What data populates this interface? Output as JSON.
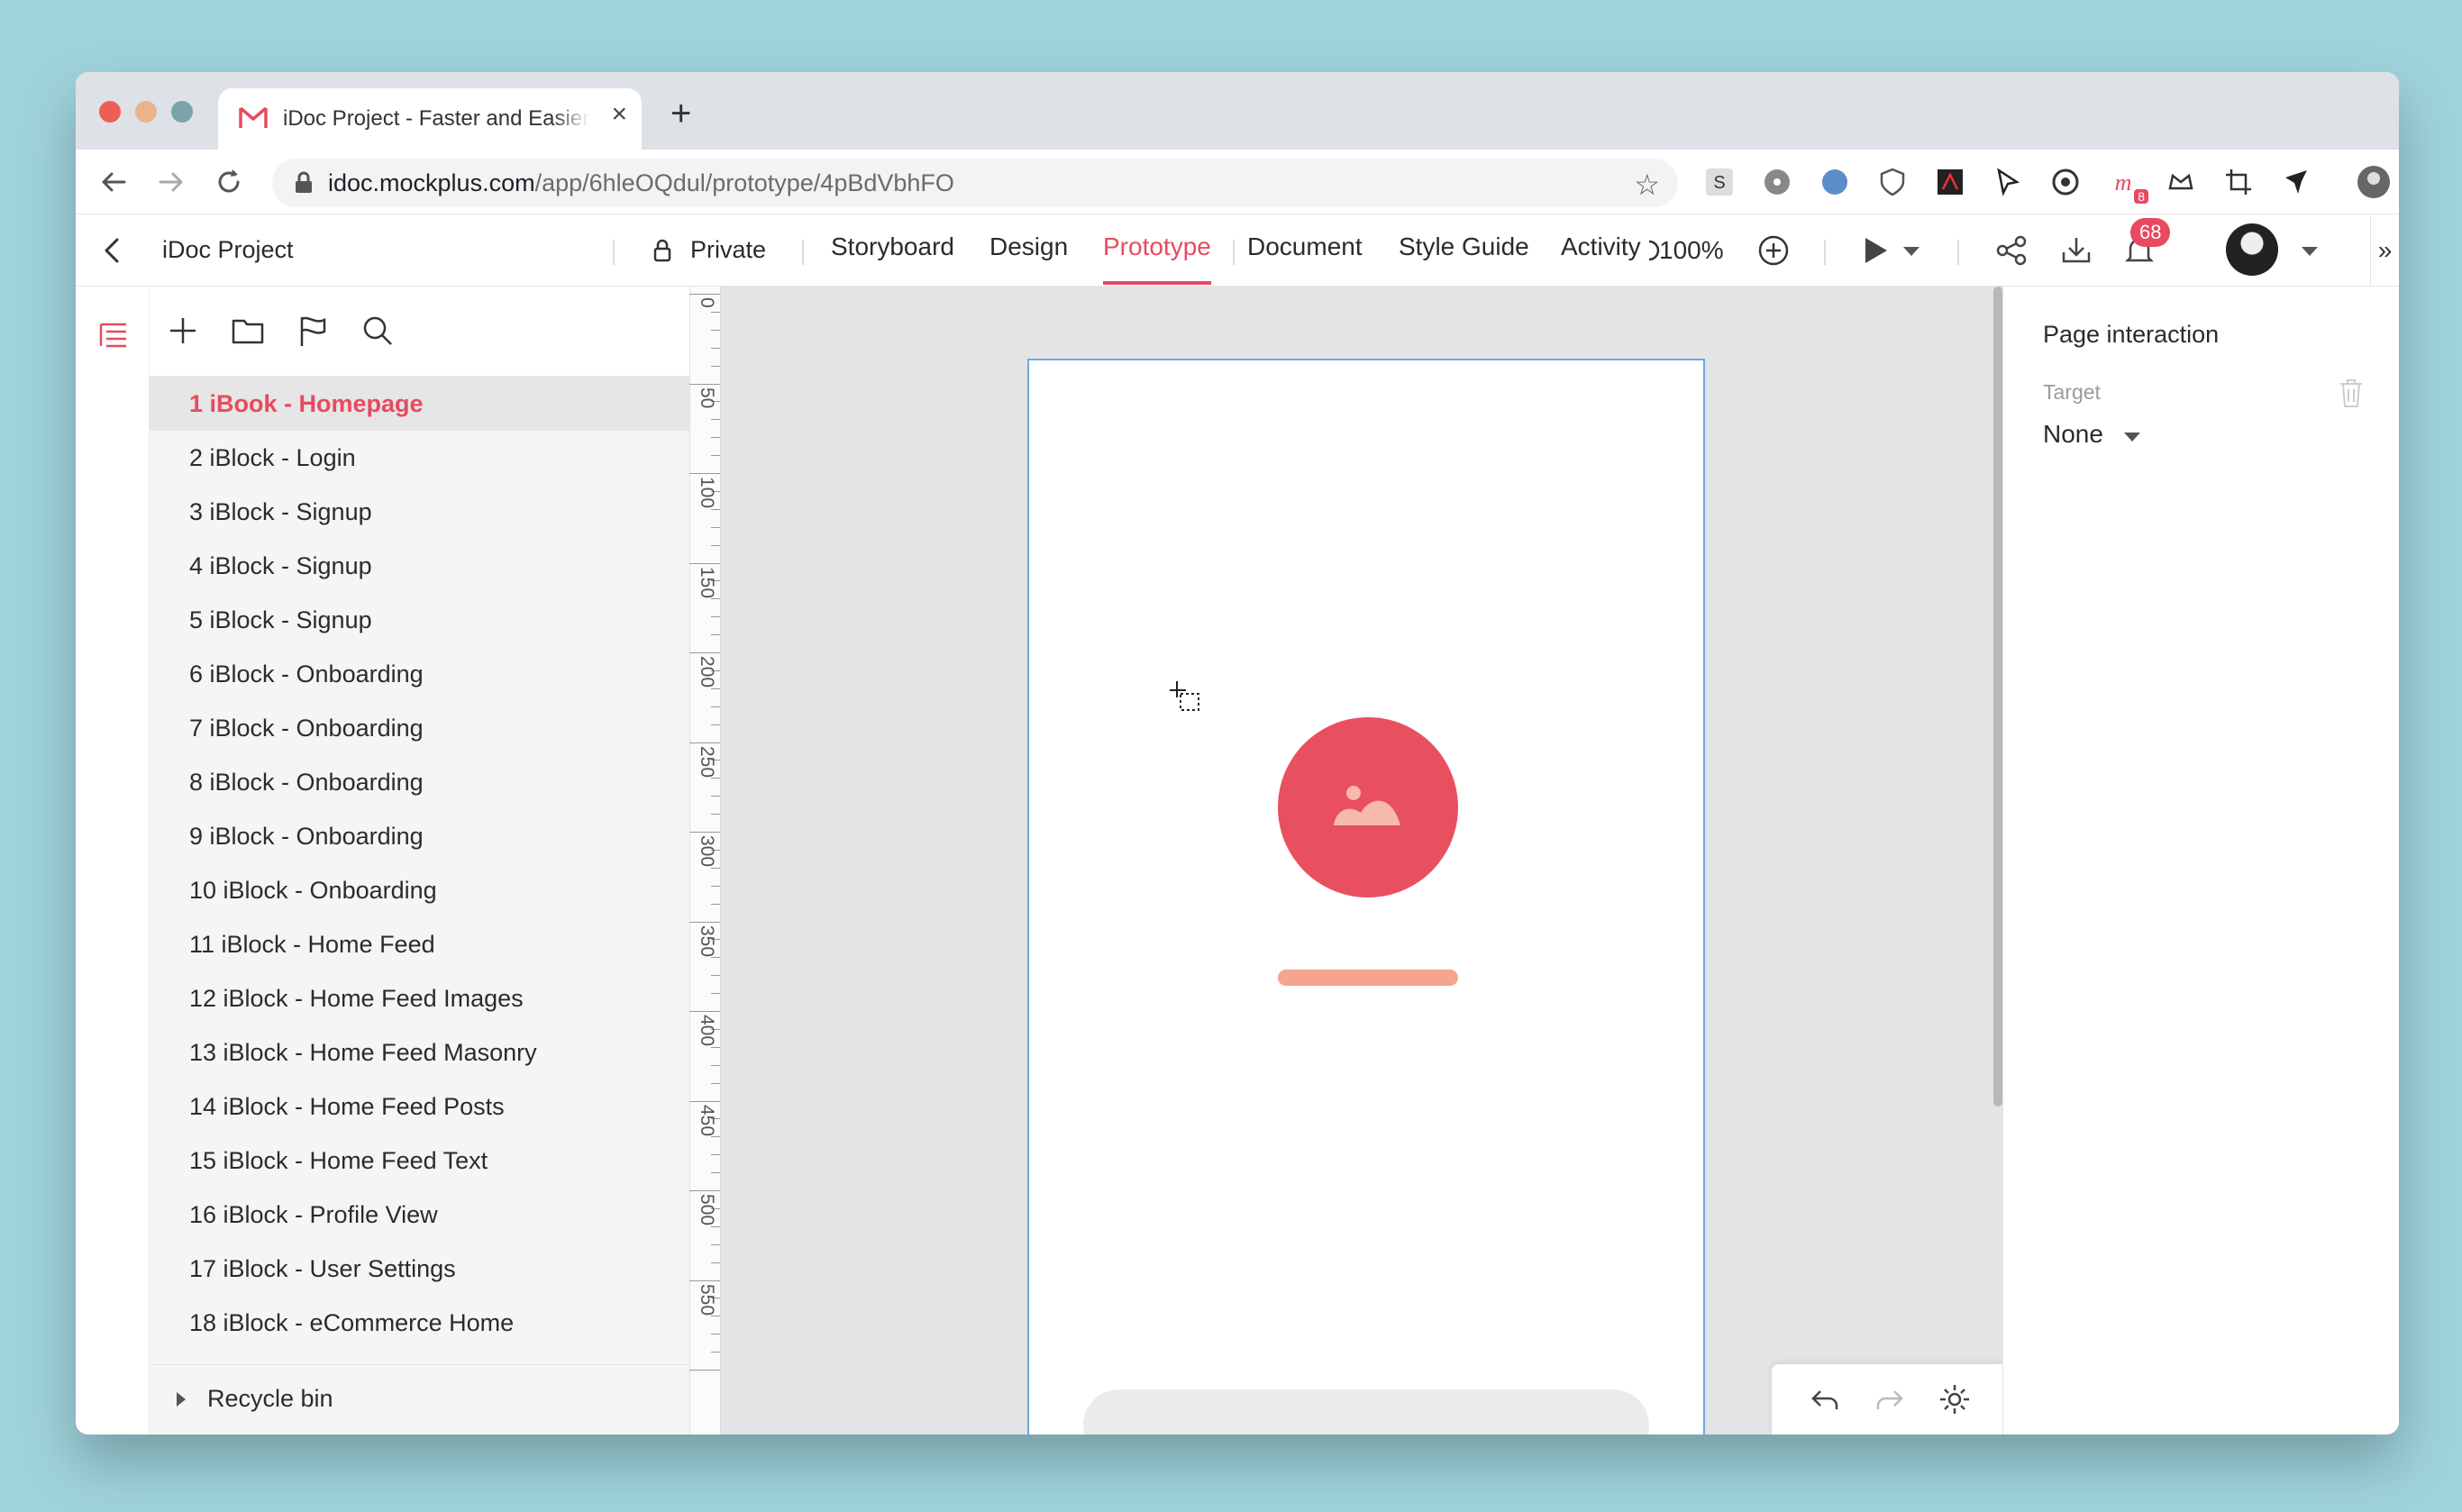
{
  "browser": {
    "tab_title": "iDoc Project - Faster and Easier Design",
    "new_tab": "+",
    "url_host": "idoc.mockplus.com",
    "url_path": "/app/6hleOQdul/prototype/4pBdVbhFO",
    "extension_badge": "8"
  },
  "app": {
    "project_name": "iDoc Project",
    "privacy": "Private",
    "tabs": [
      "Storyboard",
      "Design",
      "Prototype",
      "Document",
      "Style Guide",
      "Activity"
    ],
    "active_tab": "Prototype",
    "zoom": "100%",
    "notification_count": "68"
  },
  "pages": {
    "items": [
      "1 iBook - Homepage",
      "2 iBlock - Login",
      "3 iBlock - Signup",
      "4 iBlock - Signup",
      "5 iBlock - Signup",
      "6 iBlock - Onboarding",
      "7 iBlock - Onboarding",
      "8 iBlock - Onboarding",
      "9 iBlock - Onboarding",
      "10 iBlock - Onboarding",
      "11 iBlock - Home Feed",
      "12 iBlock - Home Feed Images",
      "13 iBlock - Home Feed Masonry",
      "14 iBlock - Home Feed Posts",
      "15 iBlock - Home Feed Text",
      "16 iBlock - Profile View",
      "17 iBlock - User Settings",
      "18 iBlock - eCommerce Home"
    ],
    "active_index": 0,
    "recycle_bin": "Recycle bin"
  },
  "ruler": {
    "labels": [
      "0",
      "50",
      "100",
      "150",
      "200",
      "250",
      "300",
      "350",
      "400",
      "450",
      "500",
      "550"
    ]
  },
  "canvas": {
    "logo_color": "#e8505f",
    "bar_color": "#f5a58f"
  },
  "inspector": {
    "title": "Page interaction",
    "target_label": "Target",
    "target_value": "None"
  },
  "colors": {
    "accent": "#e84a5f",
    "background": "#9fd3dc"
  }
}
